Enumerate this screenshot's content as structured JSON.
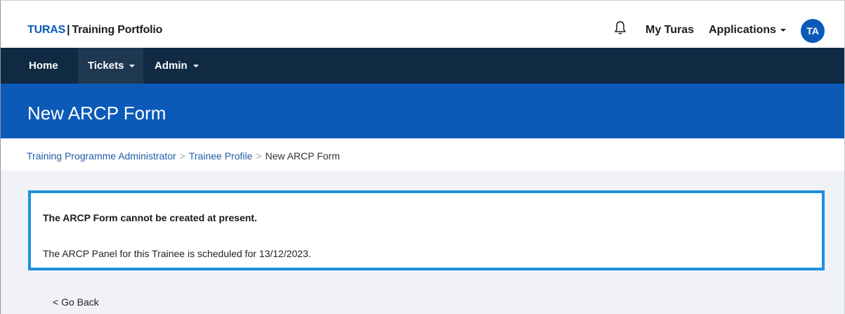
{
  "header": {
    "brand_turas": "TURAS",
    "brand_sep": "|",
    "brand_product": "Training Portfolio",
    "my_turas": "My Turas",
    "applications": "Applications",
    "avatar_initials": "TA"
  },
  "nav": {
    "items": [
      {
        "label": "Home"
      },
      {
        "label": "Tickets"
      },
      {
        "label": "Admin"
      }
    ]
  },
  "page": {
    "title": "New ARCP Form"
  },
  "breadcrumb": {
    "items": [
      {
        "label": "Training Programme Administrator"
      },
      {
        "label": "Trainee Profile"
      },
      {
        "label": "New ARCP Form"
      }
    ],
    "separator": ">"
  },
  "alert": {
    "title": "The ARCP Form cannot be created at present.",
    "message": "The ARCP Panel for this Trainee is scheduled for 13/12/2023."
  },
  "actions": {
    "go_back": "< Go Back"
  },
  "colors": {
    "brand_blue": "#0b5ab8",
    "nav_dark": "#102a43",
    "alert_border": "#1e90e0",
    "content_bg": "#f1f2f7"
  }
}
